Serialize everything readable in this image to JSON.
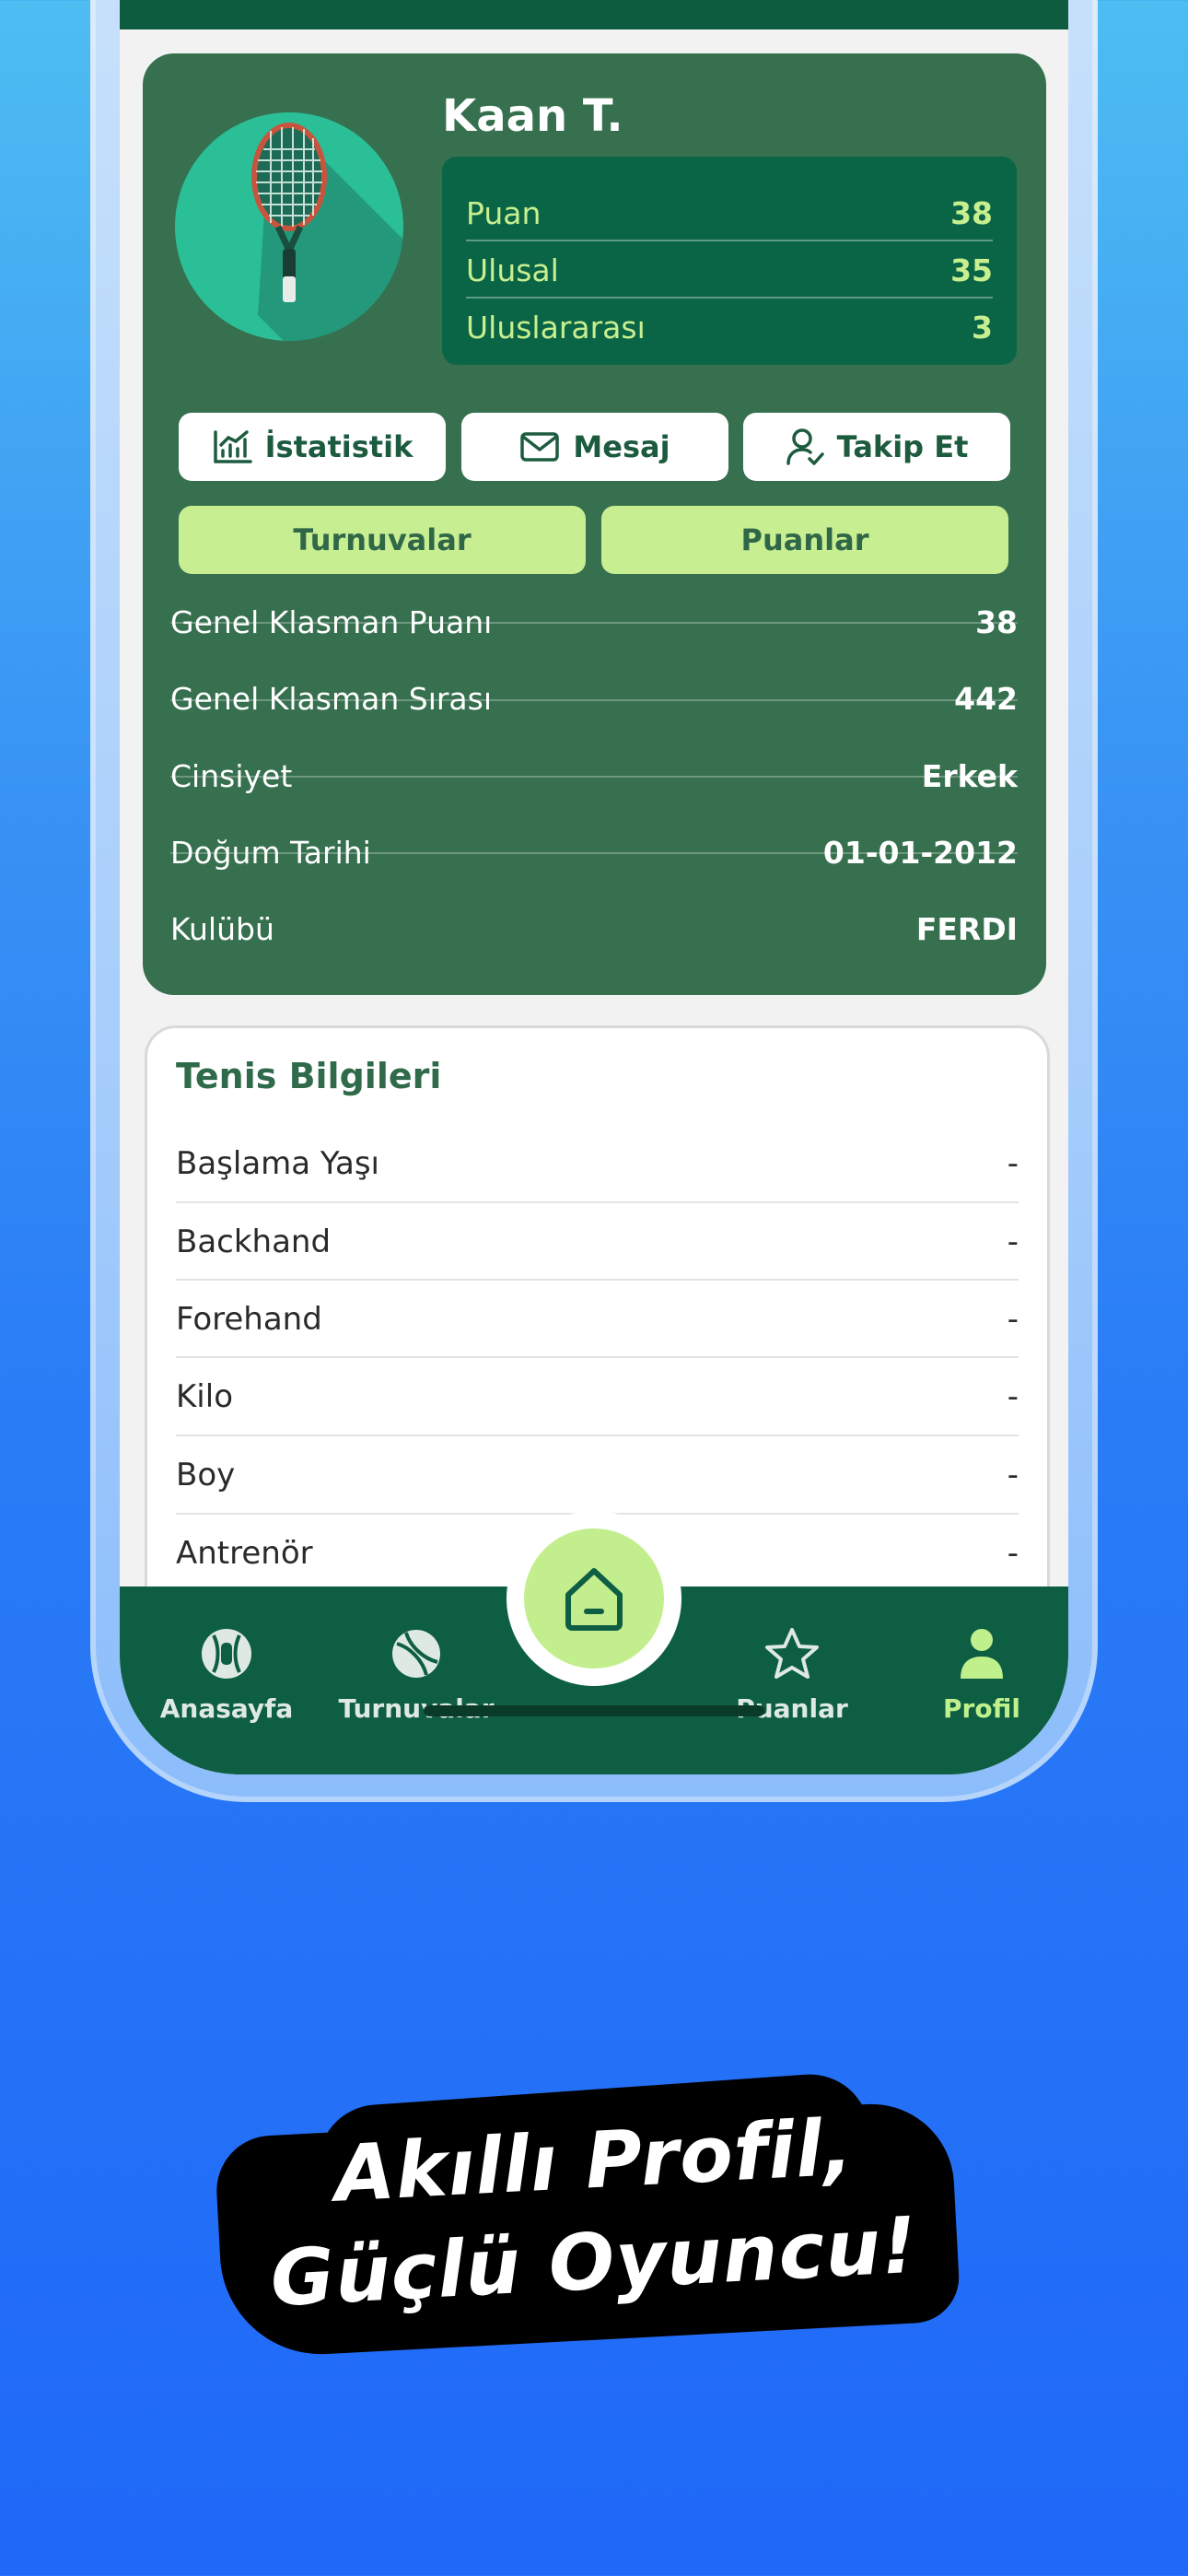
{
  "profile": {
    "name": "Kaan T.",
    "stats": [
      {
        "label": "Puan",
        "value": "38"
      },
      {
        "label": "Ulusal",
        "value": "35"
      },
      {
        "label": "Uluslararası",
        "value": "3"
      }
    ],
    "actions": {
      "statistics": "İstatistik",
      "message": "Mesaj",
      "follow": "Takip Et"
    },
    "tabs": {
      "tournaments": "Turnuvalar",
      "points": "Puanlar"
    },
    "info": [
      {
        "label": "Genel Klasman Puanı",
        "value": "38"
      },
      {
        "label": "Genel Klasman Sırası",
        "value": "442"
      },
      {
        "label": "Cinsiyet",
        "value": "Erkek"
      },
      {
        "label": "Doğum Tarihi",
        "value": "01-01-2012"
      },
      {
        "label": "Kulübü",
        "value": "FERDI"
      }
    ]
  },
  "tennis": {
    "title": "Tenis Bilgileri",
    "rows": [
      {
        "label": "Başlama Yaşı",
        "value": "-"
      },
      {
        "label": "Backhand",
        "value": "-"
      },
      {
        "label": "Forehand",
        "value": "-"
      },
      {
        "label": "Kilo",
        "value": "-"
      },
      {
        "label": "Boy",
        "value": "-"
      },
      {
        "label": "Antrenör",
        "value": "-"
      }
    ]
  },
  "nav": {
    "home": "Anasayfa",
    "tournaments": "Turnuvalar",
    "points": "Puanlar",
    "profile": "Profil",
    "active": "profile"
  },
  "tagline": {
    "line1": "Akıllı Profil,",
    "line2": "Güçlü Oyuncu!"
  },
  "icons": {
    "avatar": "tennis-racket-icon",
    "statistics": "bar-chart-icon",
    "message": "envelope-icon",
    "follow": "user-check-icon",
    "home": "house-icon",
    "home_nav": "tennis-ball-trophy-icon",
    "tournaments_nav": "tennis-ball-icon",
    "points_nav": "star-icon",
    "profile_nav": "person-icon"
  },
  "colors": {
    "card_green": "#36704f",
    "dark_green": "#0d5e42",
    "accent_lime": "#c8ee92",
    "stat_text": "#c8ef8f",
    "avatar_bg": "#2bbf98"
  }
}
